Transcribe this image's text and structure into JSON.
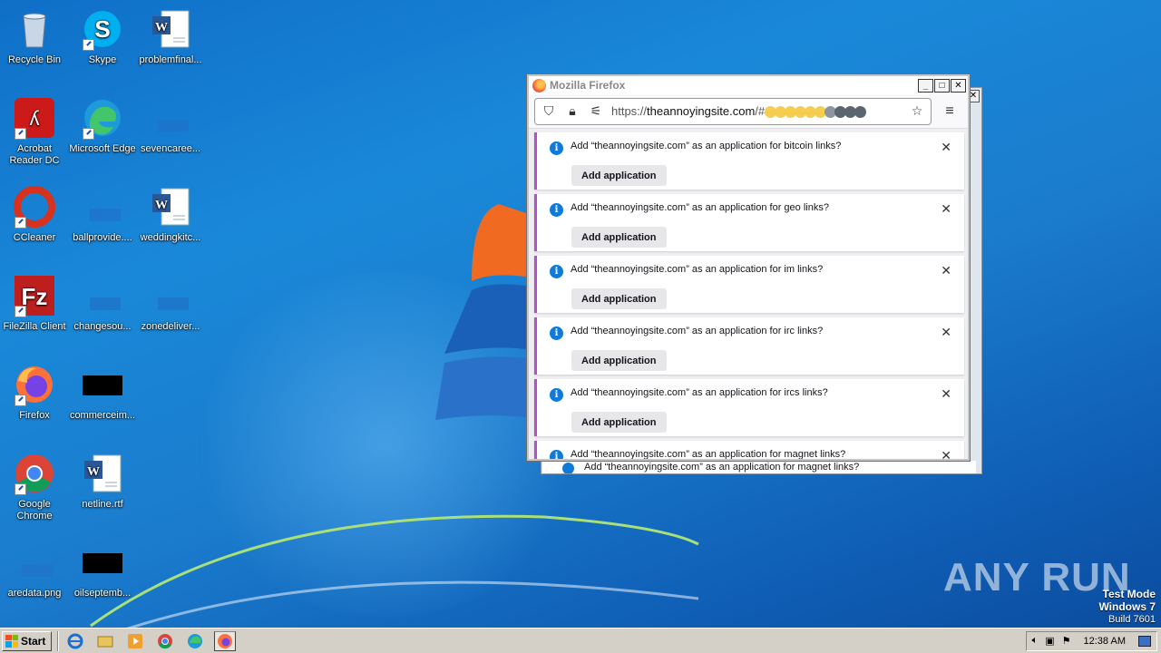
{
  "desktop": {
    "icons": [
      {
        "label": "Recycle Bin",
        "icon": "recycle-bin-icon"
      },
      {
        "label": "Skype",
        "icon": "skype-icon"
      },
      {
        "label": "problemfinal...",
        "icon": "word-doc-icon"
      },
      {
        "label": "Acrobat Reader DC",
        "icon": "acrobat-icon"
      },
      {
        "label": "Microsoft Edge",
        "icon": "edge-icon"
      },
      {
        "label": "sevencaree...",
        "icon": "blank-file-icon"
      },
      {
        "label": "CCleaner",
        "icon": "ccleaner-icon"
      },
      {
        "label": "ballprovide....",
        "icon": "blank-file-icon"
      },
      {
        "label": "weddingkitc...",
        "icon": "word-doc-icon"
      },
      {
        "label": "FileZilla Client",
        "icon": "filezilla-icon"
      },
      {
        "label": "changesou...",
        "icon": "blank-file-icon"
      },
      {
        "label": "zonedeliver...",
        "icon": "blank-file-icon"
      },
      {
        "label": "Firefox",
        "icon": "firefox-icon"
      },
      {
        "label": "commerceim...",
        "icon": "black-image-icon"
      },
      {
        "label": "Google Chrome",
        "icon": "chrome-icon"
      },
      {
        "label": "netline.rtf",
        "icon": "word-doc-icon"
      },
      {
        "label": "aredata.png",
        "icon": "blank-file-icon"
      },
      {
        "label": "oilseptemb...",
        "icon": "black-image-icon"
      }
    ]
  },
  "browser": {
    "title": "Mozilla Firefox",
    "url_prefix": "https://",
    "url_host": "theannoyingsite.com",
    "url_suffix": "/#",
    "url_dot_colors": [
      "#f5cd4f",
      "#f5cd4f",
      "#f5cd4f",
      "#f5cd4f",
      "#f5cd4f",
      "#f5cd4f",
      "#8d96a0",
      "#5b6570",
      "#5b6570",
      "#5b6570"
    ],
    "notifications": [
      {
        "message": "Add “theannoyingsite.com” as an application for bitcoin links?",
        "button": "Add application"
      },
      {
        "message": "Add “theannoyingsite.com” as an application for geo links?",
        "button": "Add application"
      },
      {
        "message": "Add “theannoyingsite.com” as an application for im links?",
        "button": "Add application"
      },
      {
        "message": "Add “theannoyingsite.com” as an application for irc links?",
        "button": "Add application"
      },
      {
        "message": "Add “theannoyingsite.com” as an application for ircs links?",
        "button": "Add application"
      },
      {
        "message": "Add “theannoyingsite.com” as an application for magnet links?",
        "button": ""
      }
    ],
    "back_window_message": "Add “theannoyingsite.com” as an application for magnet links?"
  },
  "watermark": "ANY RUN",
  "system_info": {
    "line1": "Test Mode",
    "line2": "Windows 7",
    "line3": "Build 7601"
  },
  "taskbar": {
    "start_label": "Start",
    "clock": "12:38 AM",
    "pinned": [
      "ie-icon",
      "explorer-icon",
      "media-player-icon",
      "chrome-icon",
      "edge-icon",
      "firefox-icon"
    ]
  }
}
